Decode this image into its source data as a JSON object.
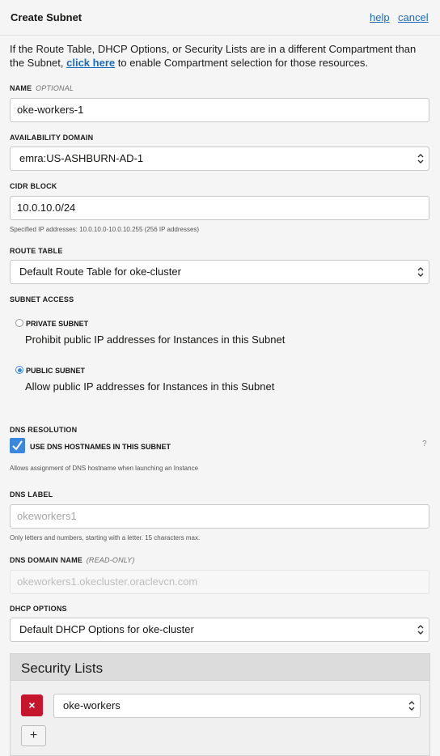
{
  "header": {
    "title": "Create Subnet",
    "help": "help",
    "cancel": "cancel"
  },
  "intro": {
    "before": "If the Route Table, DHCP Options, or Security Lists are in a different Compartment than the Subnet,",
    "link": "click here",
    "after": "to enable Compartment selection for those resources."
  },
  "name": {
    "label": "NAME",
    "hint": "OPTIONAL",
    "value": "oke-workers-1"
  },
  "availability_domain": {
    "label": "AVAILABILITY DOMAIN",
    "value": "emra:US-ASHBURN-AD-1"
  },
  "cidr": {
    "label": "CIDR BLOCK",
    "value": "10.0.10.0/24",
    "help": "Specified IP addresses: 10.0.10.0-10.0.10.255 (256 IP addresses)"
  },
  "route_table": {
    "label": "ROUTE TABLE",
    "value": "Default Route Table for oke-cluster"
  },
  "subnet_access": {
    "label": "SUBNET ACCESS",
    "options": [
      {
        "label": "PRIVATE SUBNET",
        "description": "Prohibit public IP addresses for Instances in this Subnet",
        "selected": false
      },
      {
        "label": "PUBLIC SUBNET",
        "description": "Allow public IP addresses for Instances in this Subnet",
        "selected": true
      }
    ]
  },
  "dns_resolution": {
    "label": "DNS RESOLUTION",
    "checkbox_label": "USE DNS HOSTNAMES IN THIS SUBNET",
    "checked": true,
    "help_icon": "?",
    "help": "Allows assignment of DNS hostname when launching an Instance"
  },
  "dns_label": {
    "label": "DNS LABEL",
    "placeholder": "okeworkers1",
    "help": "Only letters and numbers, starting with a letter. 15 characters max."
  },
  "dns_domain": {
    "label": "DNS DOMAIN NAME",
    "hint": "(READ-ONLY)",
    "value": "okeworkers1.okecluster.oraclevcn.com"
  },
  "dhcp": {
    "label": "DHCP OPTIONS",
    "value": "Default DHCP Options for oke-cluster"
  },
  "security_lists": {
    "title": "Security Lists",
    "items": [
      {
        "value": "oke-workers",
        "remove": "×"
      }
    ],
    "add": "+"
  },
  "colors": {
    "accent": "#3a87e0",
    "link": "#1a6bbf",
    "danger": "#c6162e"
  }
}
